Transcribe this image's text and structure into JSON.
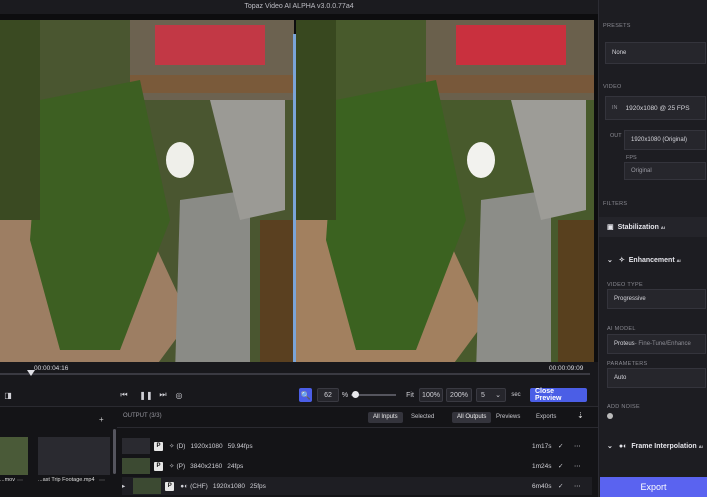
{
  "window": {
    "title": "Topaz Video AI ALPHA  v3.0.0.77a4"
  },
  "timeline": {
    "start_time": "00:00:04:16",
    "end_time": "00:00:09:09"
  },
  "controls": {
    "zoom_value": "62",
    "zoom_unit": "%",
    "fit_label": "Fit",
    "zoom_100": "100%",
    "zoom_200": "200%",
    "duration_value": "5",
    "duration_unit": "sec",
    "close_preview_label": "Close Preview"
  },
  "input_queue": {
    "items": [
      {
        "name": "...mov"
      },
      {
        "name": "...ast Trip Footage.mp4"
      }
    ]
  },
  "output": {
    "header": "OUTPUT (3/3)",
    "filters": [
      "All Inputs",
      "Selected",
      "All Outputs",
      "Previews",
      "Exports"
    ],
    "rows": [
      {
        "badge": "P",
        "tag": "(D)",
        "resolution": "1920x1080",
        "fps": "59.94fps",
        "time": "1m17s"
      },
      {
        "badge": "P",
        "tag": "(P)",
        "resolution": "3840x2160",
        "fps": "24fps",
        "time": "1m24s"
      },
      {
        "badge": "P",
        "tag": "(CHF)",
        "resolution": "1920x1080",
        "fps": "25fps",
        "time": "6m40s"
      }
    ]
  },
  "sidebar": {
    "presets_label": "PRESETS",
    "preset_value": "None",
    "video_label": "VIDEO",
    "in_tag": "IN",
    "input_info": "1920x1080 @ 25 FPS",
    "out_tag": "OUT",
    "output_info": "1920x1080 (Original)",
    "fps_label": "FPS",
    "fps_value": "Original",
    "filters_label": "FILTERS",
    "stabilization_label": "Stabilization",
    "enhancement_label": "Enhancement",
    "ai_badge": "AI",
    "video_type_label": "VIDEO TYPE",
    "video_type_value": "Progressive",
    "ai_model_label": "AI MODEL",
    "ai_model_value": "Proteus",
    "ai_model_suffix": " - Fine-Tune/Enhance",
    "parameters_label": "PARAMETERS",
    "parameters_value": "Auto",
    "add_noise_label": "ADD NOISE",
    "frame_interp_label": "Frame Interpolation",
    "export_label": "Export"
  },
  "colors": {
    "accent": "#5a63f0",
    "divider": "#7aa4d8"
  }
}
